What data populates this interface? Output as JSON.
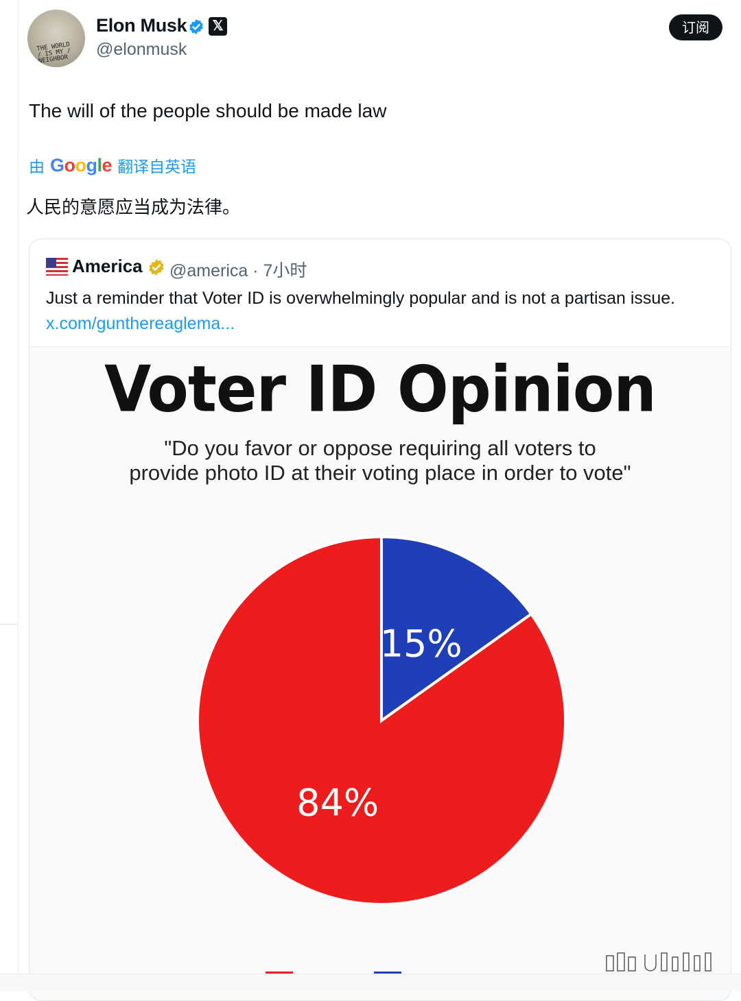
{
  "author": {
    "name": "Elon Musk",
    "handle": "@elonmusk",
    "avatar_scribble": "THE WORLD / IS MY / NEIGHBOR"
  },
  "header": {
    "subscribe_label": "订阅",
    "x_badge": "𝕏"
  },
  "tweet": {
    "text": "The will of the people should be made law",
    "translated_prefix": "由",
    "translated_brand": "Google",
    "translated_suffix": "翻译自英语",
    "translation": "人民的意愿应当成为法律。"
  },
  "quote": {
    "name": "America",
    "handle_time": "@america · 7小时",
    "text": "Just a reminder that Voter ID is overwhelmingly popular and is not a partisan issue.",
    "link": "x.com/gunthereaglema..."
  },
  "colors": {
    "favor": "#ee1c1c",
    "oppose": "#1f3fb8",
    "link": "#1d9bf0",
    "verified": "#1d9bf0",
    "gold_verified": "#e2b719"
  },
  "chart_data": {
    "type": "pie",
    "title": "Voter ID Opinion",
    "subtitle_lines": [
      "\"Do you favor or oppose requiring all voters to",
      "provide photo ID at their voting place in order to vote\""
    ],
    "slices": [
      {
        "label": "15%",
        "value": 15,
        "color": "#1f3fb8"
      },
      {
        "label": "84%",
        "value": 84,
        "color": "#ee1c1c"
      }
    ]
  }
}
